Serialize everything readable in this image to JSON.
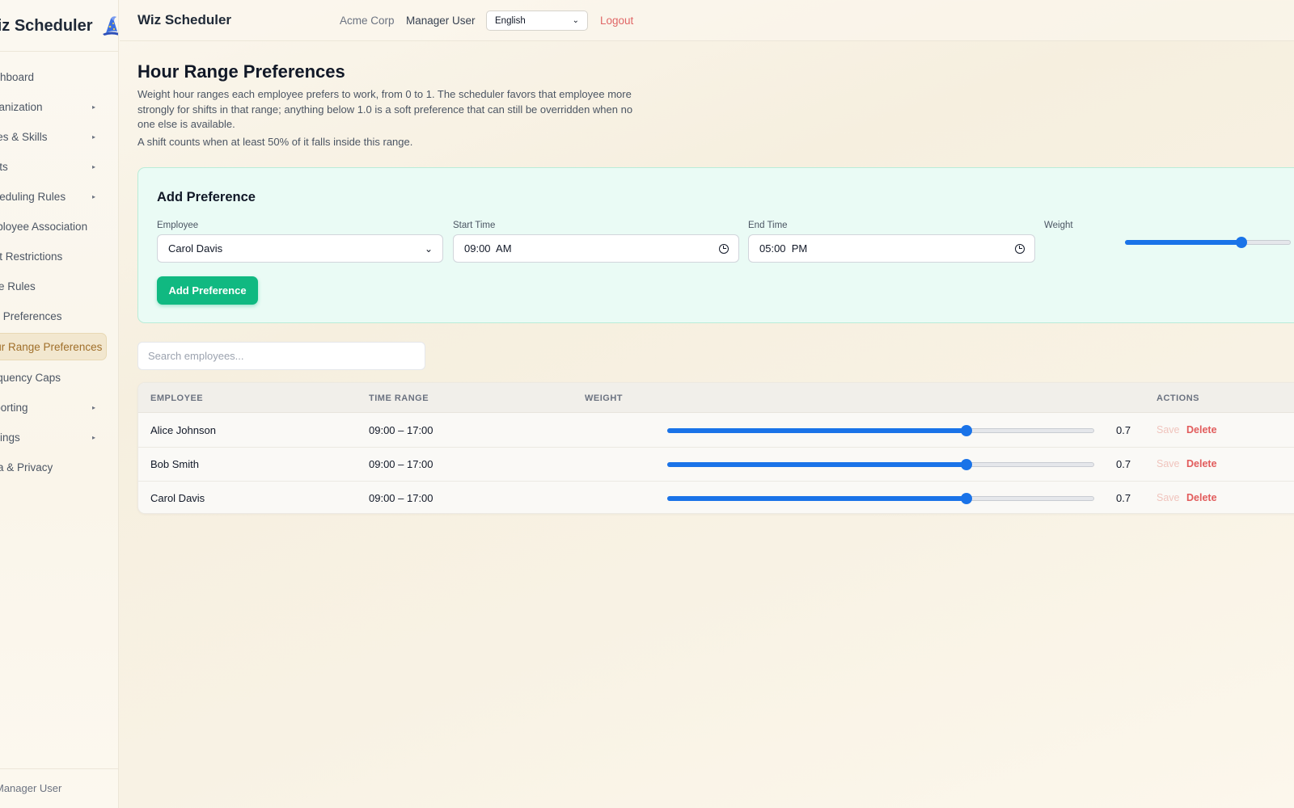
{
  "sidebar": {
    "brand": "Wiz Scheduler",
    "items": [
      {
        "label": "Dashboard",
        "arrow": ""
      },
      {
        "label": "Organization",
        "arrow": "▸"
      },
      {
        "label": "Roles & Skills",
        "arrow": "▸"
      },
      {
        "label": "Shifts",
        "arrow": "▸"
      },
      {
        "label": "Scheduling Rules",
        "arrow": "▸"
      },
      {
        "label": "Employee Association",
        "arrow": ""
      },
      {
        "label": "Shift Restrictions",
        "arrow": ""
      },
      {
        "label": "Time Rules",
        "arrow": ""
      },
      {
        "label": "Day Preferences",
        "arrow": ""
      },
      {
        "label": "Hour Range Preferences",
        "arrow": ""
      },
      {
        "label": "Frequency Caps",
        "arrow": ""
      },
      {
        "label": "Reporting",
        "arrow": "▸"
      },
      {
        "label": "Settings",
        "arrow": "▸"
      },
      {
        "label": "Data & Privacy",
        "arrow": ""
      }
    ],
    "footer": "Manager User"
  },
  "header": {
    "app_title": "Wiz Scheduler",
    "org": "Acme Corp",
    "user": "Manager User",
    "language": "English",
    "logout": "Logout"
  },
  "page": {
    "title": "Hour Range Preferences",
    "description": "Weight hour ranges each employee prefers to work, from 0 to 1. The scheduler favors that employee more strongly for shifts in that range; anything below 1.0 is a soft preference that can still be overridden when no one else is available.",
    "description2": "A shift counts when at least 50% of it falls inside this range."
  },
  "add_form": {
    "title": "Add Preference",
    "employee_label": "Employee",
    "employee_value": "Carol Davis",
    "start_label": "Start Time",
    "start_value": "09:00  AM",
    "end_label": "End Time",
    "end_value": "05:00  PM",
    "weight_label": "Weight",
    "weight_value": 0.7,
    "button": "Add Preference"
  },
  "search": {
    "placeholder": "Search employees..."
  },
  "table": {
    "headers": {
      "employee": "EMPLOYEE",
      "time_range": "TIME RANGE",
      "weight": "WEIGHT",
      "actions": "ACTIONS"
    },
    "rows": [
      {
        "employee": "Alice Johnson",
        "time_range": "09:00 – 17:00",
        "weight": 0.7,
        "weight_label": "0.7",
        "save": "Save",
        "delete": "Delete"
      },
      {
        "employee": "Bob Smith",
        "time_range": "09:00 – 17:00",
        "weight": 0.7,
        "weight_label": "0.7",
        "save": "Save",
        "delete": "Delete"
      },
      {
        "employee": "Carol Davis",
        "time_range": "09:00 – 17:00",
        "weight": 0.7,
        "weight_label": "0.7",
        "save": "Save",
        "delete": "Delete"
      }
    ]
  },
  "colors": {
    "accent": "#10b981",
    "slider": "#1a73e8",
    "danger": "#e25c5c",
    "active_nav": "#a06f2a"
  }
}
